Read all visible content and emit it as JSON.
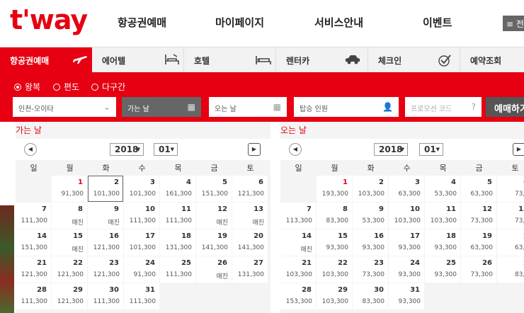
{
  "header": {
    "logo": "t'way",
    "nav": [
      "항공권예매",
      "마이페이지",
      "서비스안내",
      "이벤트"
    ],
    "all_menu": "≡ 전"
  },
  "tabs": [
    {
      "label": "항공권예매",
      "icon": "airplane-icon"
    },
    {
      "label": "에어텔",
      "icon": "bed-icon"
    },
    {
      "label": "호텔",
      "icon": "bed-icon"
    },
    {
      "label": "렌터카",
      "icon": "car-icon"
    },
    {
      "label": "체크인",
      "icon": "check-icon"
    },
    {
      "label": "예약조회",
      "icon": ""
    }
  ],
  "trip_types": [
    "왕복",
    "편도",
    "다구간"
  ],
  "form": {
    "origin": "인천-오이타",
    "depart": "가는 날",
    "return": "오는 날",
    "passengers": "탑승 인원",
    "promo": "프로모션 코드",
    "book": "예매하기"
  },
  "calendars": [
    {
      "title": "가는 날",
      "year": "2018",
      "month": "01",
      "dow": [
        "일",
        "월",
        "화",
        "수",
        "목",
        "금",
        "토"
      ],
      "weeks": [
        [
          null,
          {
            "d": "1",
            "p": "91,300",
            "red": true
          },
          {
            "d": "2",
            "p": "101,300",
            "sel": true
          },
          {
            "d": "3",
            "p": "101,300"
          },
          {
            "d": "4",
            "p": "161,300"
          },
          {
            "d": "5",
            "p": "151,300"
          },
          {
            "d": "6",
            "p": "121,300"
          }
        ],
        [
          {
            "d": "7",
            "p": "111,300"
          },
          {
            "d": "8",
            "p": "매진"
          },
          {
            "d": "9",
            "p": "매진"
          },
          {
            "d": "10",
            "p": "111,300"
          },
          {
            "d": "11",
            "p": "111,300"
          },
          {
            "d": "12",
            "p": "매진"
          },
          {
            "d": "13",
            "p": "매진"
          }
        ],
        [
          {
            "d": "14",
            "p": "151,300"
          },
          {
            "d": "15",
            "p": "매진"
          },
          {
            "d": "16",
            "p": "121,300"
          },
          {
            "d": "17",
            "p": "101,300"
          },
          {
            "d": "18",
            "p": "131,300"
          },
          {
            "d": "19",
            "p": "141,300"
          },
          {
            "d": "20",
            "p": "141,300"
          }
        ],
        [
          {
            "d": "21",
            "p": "121,300"
          },
          {
            "d": "22",
            "p": "121,300"
          },
          {
            "d": "23",
            "p": "121,300"
          },
          {
            "d": "24",
            "p": "91,300"
          },
          {
            "d": "25",
            "p": "111,300"
          },
          {
            "d": "26",
            "p": "매진"
          },
          {
            "d": "27",
            "p": "131,300"
          }
        ],
        [
          {
            "d": "28",
            "p": "111,300"
          },
          {
            "d": "29",
            "p": "121,300"
          },
          {
            "d": "30",
            "p": "111,300"
          },
          {
            "d": "31",
            "p": "111,300"
          },
          null,
          null,
          null
        ]
      ]
    },
    {
      "title": "오는 날",
      "year": "2018",
      "month": "01",
      "dow": [
        "일",
        "월",
        "화",
        "수",
        "목",
        "금",
        "토"
      ],
      "weeks": [
        [
          null,
          {
            "d": "1",
            "p": "193,300",
            "red": true
          },
          {
            "d": "2",
            "p": "103,300"
          },
          {
            "d": "3",
            "p": "63,300"
          },
          {
            "d": "4",
            "p": "53,300"
          },
          {
            "d": "5",
            "p": "63,300"
          },
          {
            "d": "6",
            "p": "73,3"
          }
        ],
        [
          {
            "d": "7",
            "p": "113,300"
          },
          {
            "d": "8",
            "p": "83,300"
          },
          {
            "d": "9",
            "p": "53,300"
          },
          {
            "d": "10",
            "p": "103,300"
          },
          {
            "d": "11",
            "p": "103,300"
          },
          {
            "d": "12",
            "p": "73,300"
          },
          {
            "d": "13",
            "p": "73,3"
          }
        ],
        [
          {
            "d": "14",
            "p": "매진"
          },
          {
            "d": "15",
            "p": "93,300"
          },
          {
            "d": "16",
            "p": "93,300"
          },
          {
            "d": "17",
            "p": "93,300"
          },
          {
            "d": "18",
            "p": "93,300"
          },
          {
            "d": "19",
            "p": "63,300"
          },
          {
            "d": "2",
            "p": "63,3"
          }
        ],
        [
          {
            "d": "21",
            "p": "103,300"
          },
          {
            "d": "22",
            "p": "103,300"
          },
          {
            "d": "23",
            "p": "73,300"
          },
          {
            "d": "24",
            "p": "93,300"
          },
          {
            "d": "25",
            "p": "93,300"
          },
          {
            "d": "26",
            "p": "73,300"
          },
          {
            "d": "2",
            "p": "83,3"
          }
        ],
        [
          {
            "d": "28",
            "p": "153,300"
          },
          {
            "d": "29",
            "p": "103,300"
          },
          {
            "d": "30",
            "p": "83,300"
          },
          {
            "d": "31",
            "p": "93,300"
          },
          null,
          null,
          null
        ]
      ]
    }
  ],
  "colors": {
    "brand": "#e60012",
    "dark": "#555555"
  }
}
